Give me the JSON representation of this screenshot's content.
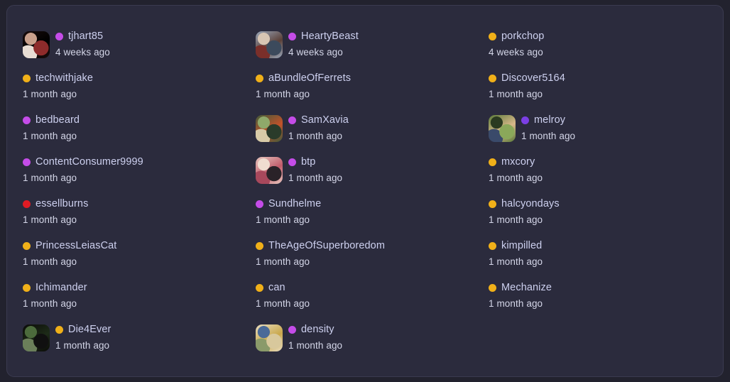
{
  "theme": {
    "page_background": "#22222e",
    "card_background": "#2b2b3d",
    "card_border": "#3b3b50",
    "username_color": "#cdd0ef",
    "timestamp_color": "#d4d6e8",
    "dot_purple_bright": "#c44ce8",
    "dot_purple_deep": "#7b3fe4",
    "dot_yellow": "#f0b019",
    "dot_red": "#e01b24"
  },
  "columns": [
    {
      "name": "column-1",
      "entries": [
        {
          "username": "tjhart85",
          "timestamp": "4 weeks ago",
          "dot_color": "#c44ce8",
          "dot_name": "status-dot-purple",
          "has_avatar": true,
          "avatar_name": "avatar-tjhart85",
          "avatar_colors": [
            "#1a0d0d",
            "#000000",
            "#c9a08c",
            "#8e2b2b",
            "#e8ddd4"
          ]
        },
        {
          "username": "techwithjake",
          "timestamp": "1 month ago",
          "dot_color": "#f0b019",
          "dot_name": "status-dot-yellow",
          "has_avatar": false
        },
        {
          "username": "bedbeard",
          "timestamp": "1 month ago",
          "dot_color": "#c44ce8",
          "dot_name": "status-dot-purple",
          "has_avatar": false
        },
        {
          "username": "ContentConsumer9999",
          "timestamp": "1 month ago",
          "dot_color": "#c44ce8",
          "dot_name": "status-dot-purple",
          "has_avatar": false
        },
        {
          "username": "essellburns",
          "timestamp": "1 month ago",
          "dot_color": "#e01b24",
          "dot_name": "status-dot-red",
          "has_avatar": false
        },
        {
          "username": "PrincessLeiasCat",
          "timestamp": "1 month ago",
          "dot_color": "#f0b019",
          "dot_name": "status-dot-yellow",
          "has_avatar": false
        },
        {
          "username": "Ichimander",
          "timestamp": "1 month ago",
          "dot_color": "#f0b019",
          "dot_name": "status-dot-yellow",
          "has_avatar": false
        },
        {
          "username": "Die4Ever",
          "timestamp": "1 month ago",
          "dot_color": "#f0b019",
          "dot_name": "status-dot-yellow",
          "has_avatar": true,
          "avatar_name": "avatar-die4ever",
          "avatar_colors": [
            "#0b0b08",
            "#1d2b18",
            "#4c6b3c",
            "#101010",
            "#6b7f5a"
          ]
        }
      ]
    },
    {
      "name": "column-2",
      "entries": [
        {
          "username": "HeartyBeast",
          "timestamp": "4 weeks ago",
          "dot_color": "#c44ce8",
          "dot_name": "status-dot-purple",
          "has_avatar": true,
          "avatar_name": "avatar-heartybeast",
          "avatar_colors": [
            "#9aa8bb",
            "#5b4038",
            "#d8c6b4",
            "#3c4a5c",
            "#7a2f2a"
          ]
        },
        {
          "username": "aBundleOfFerrets",
          "timestamp": "1 month ago",
          "dot_color": "#f0b019",
          "dot_name": "status-dot-yellow",
          "has_avatar": false
        },
        {
          "username": "SamXavia",
          "timestamp": "1 month ago",
          "dot_color": "#c44ce8",
          "dot_name": "status-dot-purple",
          "has_avatar": true,
          "avatar_name": "avatar-samxavia",
          "avatar_colors": [
            "#3f5a3a",
            "#c2522a",
            "#8fa86a",
            "#2a3b2a",
            "#d8cba8"
          ]
        },
        {
          "username": "btp",
          "timestamp": "1 month ago",
          "dot_color": "#c44ce8",
          "dot_name": "status-dot-purple",
          "has_avatar": true,
          "avatar_name": "avatar-btp",
          "avatar_colors": [
            "#e8c8c0",
            "#c05a6a",
            "#f0dcd0",
            "#2a2228",
            "#a8485c"
          ]
        },
        {
          "username": "Sundhelme",
          "timestamp": "1 month ago",
          "dot_color": "#c44ce8",
          "dot_name": "status-dot-purple",
          "has_avatar": false
        },
        {
          "username": "TheAgeOfSuperboredom",
          "timestamp": "1 month ago",
          "dot_color": "#f0b019",
          "dot_name": "status-dot-yellow",
          "has_avatar": false
        },
        {
          "username": "can",
          "timestamp": "1 month ago",
          "dot_color": "#f0b019",
          "dot_name": "status-dot-yellow",
          "has_avatar": false
        },
        {
          "username": "density",
          "timestamp": "1 month ago",
          "dot_color": "#c44ce8",
          "dot_name": "status-dot-purple",
          "has_avatar": true,
          "avatar_name": "avatar-density",
          "avatar_colors": [
            "#e8dcc0",
            "#c9a84c",
            "#4a6a98",
            "#d8c89c",
            "#8a9a6a"
          ]
        }
      ]
    },
    {
      "name": "column-3",
      "entries": [
        {
          "username": "porkchop",
          "timestamp": "4 weeks ago",
          "dot_color": "#f0b019",
          "dot_name": "status-dot-yellow",
          "has_avatar": false
        },
        {
          "username": "Discover5164",
          "timestamp": "1 month ago",
          "dot_color": "#f0b019",
          "dot_name": "status-dot-yellow",
          "has_avatar": false
        },
        {
          "username": "melroy",
          "timestamp": "1 month ago",
          "dot_color": "#7b3fe4",
          "dot_name": "status-dot-purple-deep",
          "has_avatar": true,
          "avatar_name": "avatar-melroy",
          "avatar_colors": [
            "#5a7a3a",
            "#d8b88a",
            "#2a3a20",
            "#8aa85a",
            "#3a4a6a"
          ]
        },
        {
          "username": "mxcory",
          "timestamp": "1 month ago",
          "dot_color": "#f0b019",
          "dot_name": "status-dot-yellow",
          "has_avatar": false
        },
        {
          "username": "halcyondays",
          "timestamp": "1 month ago",
          "dot_color": "#f0b019",
          "dot_name": "status-dot-yellow",
          "has_avatar": false
        },
        {
          "username": "kimpilled",
          "timestamp": "1 month ago",
          "dot_color": "#f0b019",
          "dot_name": "status-dot-yellow",
          "has_avatar": false
        },
        {
          "username": "Mechanize",
          "timestamp": "1 month ago",
          "dot_color": "#f0b019",
          "dot_name": "status-dot-yellow",
          "has_avatar": false
        }
      ]
    }
  ]
}
